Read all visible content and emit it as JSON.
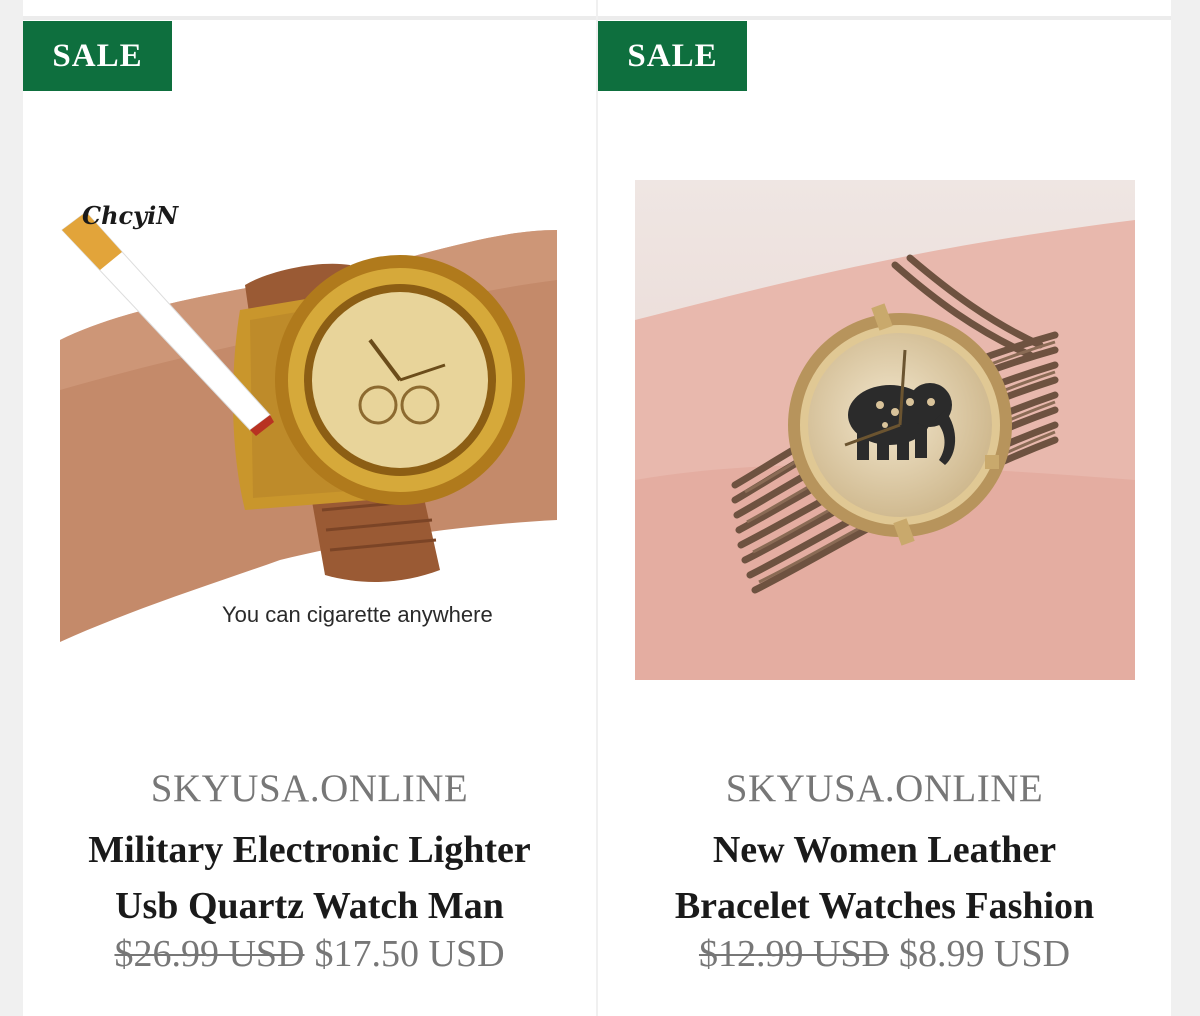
{
  "products": [
    {
      "badge": "SALE",
      "vendor": "SKYUSA.ONLINE",
      "title_line1": "Military Electronic Lighter",
      "title_line2": "Usb Quartz Watch Man",
      "price_original": "$26.99 USD",
      "price_sale": "$17.50 USD",
      "image": {
        "brand_logo": "ChcyiN",
        "caption": "You can cigarette anywhere"
      }
    },
    {
      "badge": "SALE",
      "vendor": "SKYUSA.ONLINE",
      "title_line1": "New Women Leather",
      "title_line2": "Bracelet Watches Fashion",
      "price_original": "$12.99 USD",
      "price_sale": "$8.99 USD"
    }
  ],
  "colors": {
    "sale_badge": "#0e6f3e",
    "vendor_text": "#777777",
    "title_text": "#1a1a1a",
    "background": "#f0f0f0"
  }
}
